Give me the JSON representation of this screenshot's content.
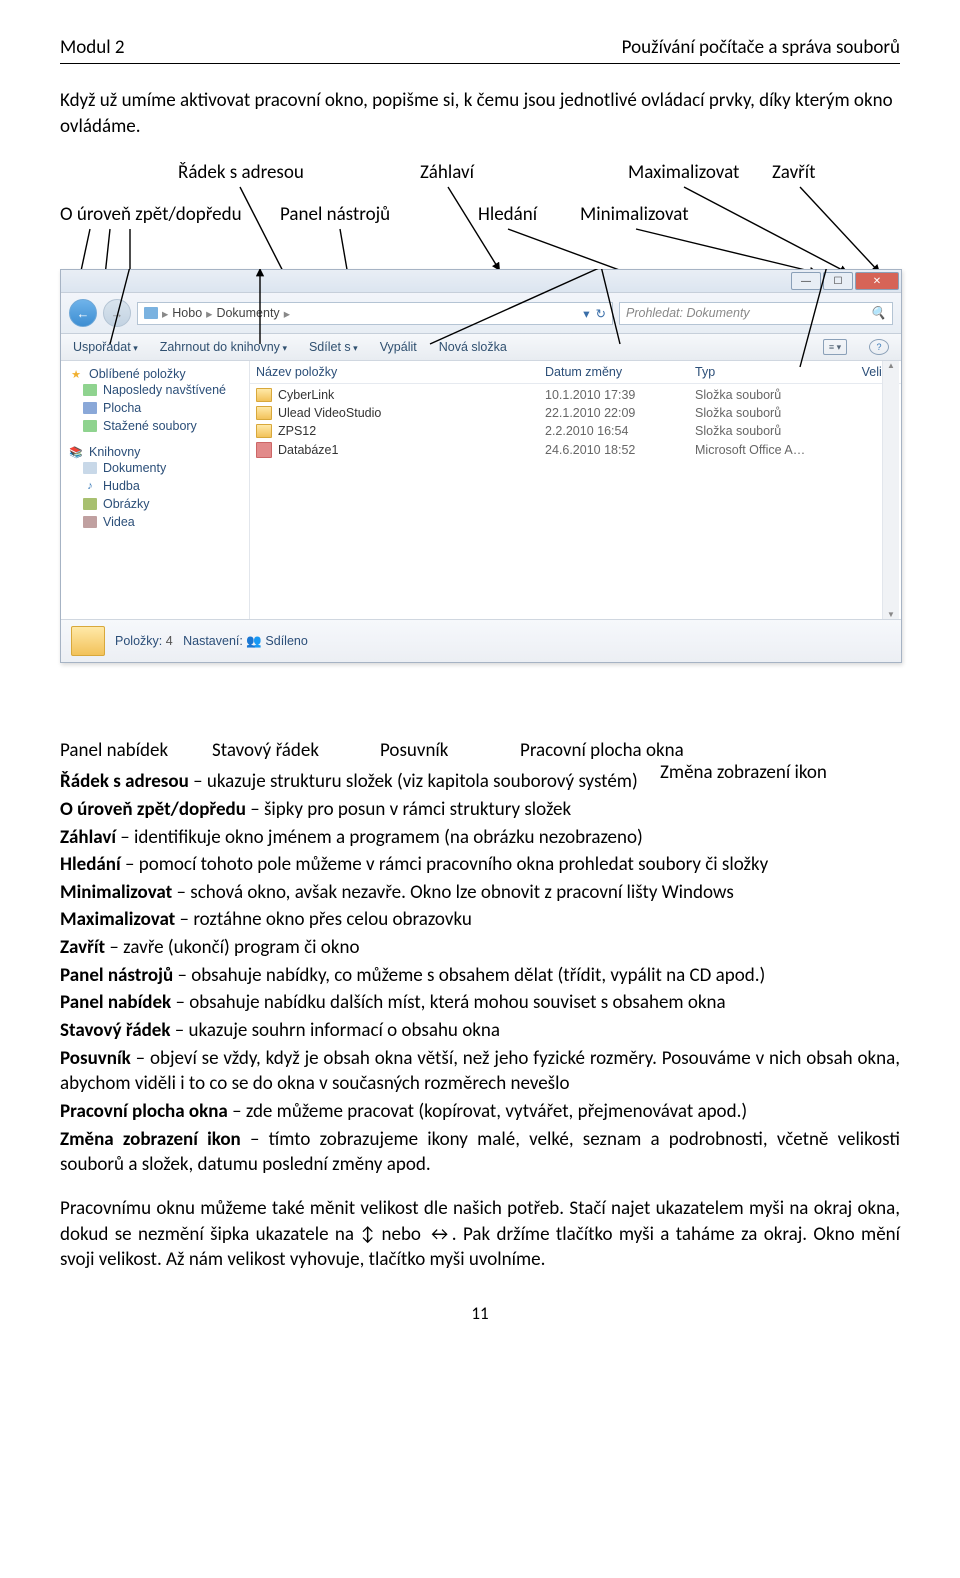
{
  "header": {
    "left": "Modul 2",
    "right": "Používání počítače a správa souborů"
  },
  "intro": "Když už umíme aktivovat pracovní okno, popišme si, k čemu jsou jednotlivé ovládací prvky, díky kterým okno ovládáme.",
  "labels_top": {
    "radek_s_adresou": "Řádek s adresou",
    "zahlavi": "Záhlaví",
    "maximalizovat": "Maximalizovat",
    "zavrit": "Zavřít",
    "o_uroven": "O úroveň zpět/dopředu",
    "panel_nastroju": "Panel nástrojů",
    "hledani": "Hledání",
    "minimalizovat": "Minimalizovat"
  },
  "explorer": {
    "address": {
      "parts": [
        "Hobo",
        "Dokumenty"
      ],
      "refresh": "↻"
    },
    "search_placeholder": "Prohledat: Dokumenty",
    "search_icon": "🔍",
    "toolbar": {
      "usporadat": "Uspořádat",
      "zahrnout": "Zahrnout do knihovny",
      "sdilet": "Sdílet s",
      "vypalit": "Vypálit",
      "nova": "Nová složka"
    },
    "sidebar": {
      "oblibene": "Oblíbené položky",
      "naposledy": "Naposledy navštívené",
      "plocha": "Plocha",
      "stazene": "Stažené soubory",
      "knihovny": "Knihovny",
      "dokumenty": "Dokumenty",
      "hudba": "Hudba",
      "obrazky": "Obrázky",
      "videa": "Videa"
    },
    "columns": {
      "name": "Název položky",
      "date": "Datum změny",
      "type": "Typ",
      "size": "Veliko"
    },
    "rows": [
      {
        "name": "CyberLink",
        "date": "10.1.2010 17:39",
        "type": "Složka souborů",
        "kind": "folder"
      },
      {
        "name": "Ulead VideoStudio",
        "date": "22.1.2010 22:09",
        "type": "Složka souborů",
        "kind": "folder"
      },
      {
        "name": "ZPS12",
        "date": "2.2.2010 16:54",
        "type": "Složka souborů",
        "kind": "folder"
      },
      {
        "name": "Databáze1",
        "date": "24.6.2010 18:52",
        "type": "Microsoft Office A…",
        "kind": "access"
      }
    ],
    "status": {
      "polozky_label": "Položky:",
      "polozky_value": "4",
      "nastaveni": "Nastavení:",
      "sdileno": "Sdíleno"
    }
  },
  "labels_bottom": {
    "panel_nabidek": "Panel nabídek",
    "stavovy_radek": "Stavový řádek",
    "posuvnik": "Posuvník",
    "pracovni_plocha": "Pracovní plocha okna",
    "zmena_zobrazeni": "Změna zobrazení ikon"
  },
  "definitions": [
    {
      "b": "Řádek s adresou",
      "t": " – ukazuje strukturu složek (viz kapitola souborový systém)"
    },
    {
      "b": "O úroveň zpět/dopředu",
      "t": " – šipky pro posun v rámci struktury složek"
    },
    {
      "b": "Záhlaví",
      "t": " – identifikuje okno jménem a programem (na obrázku nezobrazeno)"
    },
    {
      "b": "Hledání",
      "t": " – pomocí tohoto pole můžeme v rámci pracovního okna prohledat soubory či složky"
    },
    {
      "b": "Minimalizovat",
      "t": " – schová okno, avšak nezavře. Okno lze obnovit z pracovní lišty Windows"
    },
    {
      "b": "Maximalizovat",
      "t": " – roztáhne okno přes celou obrazovku"
    },
    {
      "b": "Zavřít",
      "t": " – zavře (ukončí) program či okno"
    },
    {
      "b": "Panel nástrojů",
      "t": " – obsahuje nabídky, co můžeme s obsahem dělat (třídit, vypálit na CD apod.)"
    },
    {
      "b": "Panel nabídek",
      "t": " – obsahuje nabídku dalších míst, která mohou souviset s obsahem okna"
    },
    {
      "b": "Stavový řádek",
      "t": " – ukazuje souhrn informací o obsahu okna"
    },
    {
      "b": "Posuvník",
      "t": " – objeví se vždy, když je obsah okna větší, než jeho fyzické rozměry. Posouváme v nich obsah okna, abychom viděli i to co se do okna v současných rozměrech nevešlo"
    },
    {
      "b": "Pracovní plocha okna",
      "t": " – zde můžeme pracovat (kopírovat, vytvářet, přejmenovávat apod.)"
    },
    {
      "b": "Změna zobrazení ikon",
      "t": " – tímto zobrazujeme ikony malé, velké, seznam a podrobnosti, včetně velikosti souborů a složek, datumu poslední změny apod."
    }
  ],
  "outro": "Pracovnímu oknu můžeme také měnit velikost dle našich potřeb. Stačí najet ukazatelem myši na okraj okna, dokud se nezmění šipka ukazatele na ↕ nebo ↔. Pak držíme tlačítko myši a taháme za okraj. Okno mění svoji velikost. Až nám velikost vyhovuje, tlačítko myši uvolníme.",
  "page_number": "11"
}
